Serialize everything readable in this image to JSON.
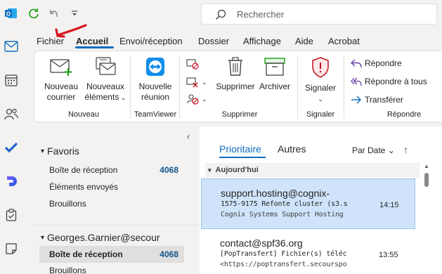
{
  "search": {
    "placeholder": "Rechercher"
  },
  "menu": {
    "tabs": [
      "Fichier",
      "Accueil",
      "Envoi/réception",
      "Dossier",
      "Affichage",
      "Aide",
      "Acrobat"
    ],
    "active": "Accueil"
  },
  "ribbon": {
    "new_mail": "Nouveau courrier",
    "new_mail_l1": "Nouveau",
    "new_mail_l2": "courrier",
    "new_items_l1": "Nouveaux",
    "new_items_l2": "éléments",
    "group_new": "Nouveau",
    "teamviewer_l1": "Nouvelle",
    "teamviewer_l2": "réunion",
    "group_teamviewer": "TeamViewer",
    "delete": "Supprimer",
    "archive": "Archiver",
    "group_delete": "Supprimer",
    "report": "Signaler",
    "group_report": "Signaler",
    "reply": "Répondre",
    "reply_all": "Répondre à tous",
    "forward": "Transférer",
    "group_respond": "Répondre"
  },
  "folders": {
    "favorites_header": "Favoris",
    "favorites": [
      {
        "label": "Boîte de réception",
        "count": "4068"
      },
      {
        "label": "Éléments envoyés",
        "count": ""
      },
      {
        "label": "Brouillons",
        "count": ""
      }
    ],
    "account_header": "Georges.Garnier@secour",
    "account_items": [
      {
        "label": "Boîte de réception",
        "count": "4068"
      },
      {
        "label": "Brouillons",
        "count": ""
      }
    ]
  },
  "messagelist": {
    "tab_focused": "Prioritaire",
    "tab_other": "Autres",
    "sort": "Par Date",
    "group_today": "Aujourd'hui",
    "messages": [
      {
        "from": "support.hosting@cognix-",
        "subject": "1575-9175 Refonte cluster (s3.s4.",
        "preview": "Cognix Systems  Support Hosting",
        "time": "14:15"
      },
      {
        "from": "contact@spf36.org",
        "subject": "[PopTransfert] Fichier(s) téléchar",
        "preview": "<https://poptransfert.secourspopu",
        "time": "13:55"
      }
    ]
  },
  "colors": {
    "accent": "#0f6cbd",
    "selected": "#cfe4fa",
    "outlook_blue": "#0f6cbd",
    "report_red": "#c50f1f"
  }
}
